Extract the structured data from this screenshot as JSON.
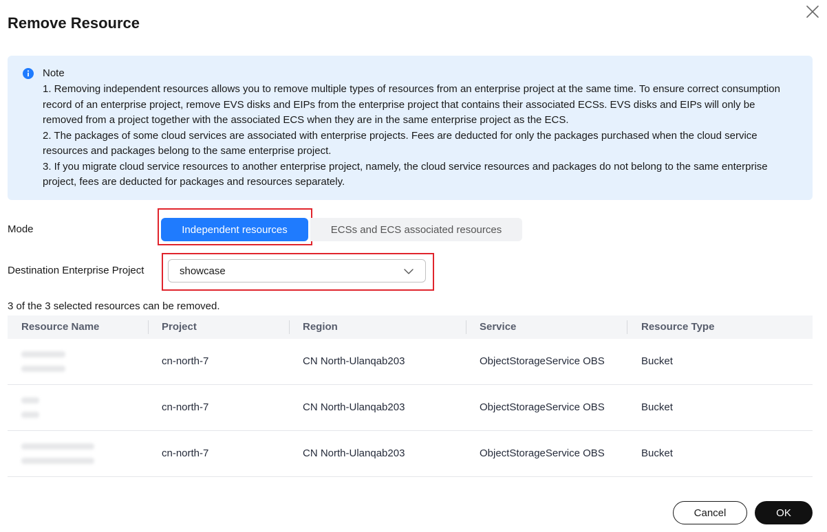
{
  "dialog": {
    "title": "Remove Resource"
  },
  "note": {
    "title": "Note",
    "lines": [
      "1. Removing independent resources allows you to remove multiple types of resources from an enterprise project at the same time. To ensure correct consumption",
      "record of an enterprise project, remove EVS disks and EIPs from the enterprise project that contains their associated ECSs. EVS disks and EIPs will only be",
      "removed from a project together with the associated ECS when they are in the same enterprise project as the ECS.",
      "2. The packages of some cloud services are associated with enterprise projects. Fees are deducted for only the packages purchased when the cloud service",
      "resources and packages belong to the same enterprise project.",
      "3. If you migrate cloud service resources to another enterprise project, namely, the cloud service resources and packages do not belong to the same enterprise",
      "project, fees are deducted for packages and resources separately."
    ]
  },
  "mode": {
    "label": "Mode",
    "options": [
      "Independent resources",
      "ECSs and ECS associated resources"
    ],
    "selected_index": 0
  },
  "destination": {
    "label": "Destination Enterprise Project",
    "value": "showcase"
  },
  "summary": {
    "text": "3 of the 3 selected resources can be removed."
  },
  "table": {
    "columns": [
      "Resource Name",
      "Project",
      "Region",
      "Service",
      "Resource Type"
    ],
    "rows": [
      {
        "project": "cn-north-7",
        "region": "CN North-Ulanqab203",
        "service": "ObjectStorageService OBS",
        "type": "Bucket"
      },
      {
        "project": "cn-north-7",
        "region": "CN North-Ulanqab203",
        "service": "ObjectStorageService OBS",
        "type": "Bucket"
      },
      {
        "project": "cn-north-7",
        "region": "CN North-Ulanqab203",
        "service": "ObjectStorageService OBS",
        "type": "Bucket"
      }
    ]
  },
  "footer": {
    "cancel_label": "Cancel",
    "ok_label": "OK"
  },
  "colors": {
    "primary": "#1f7bfe",
    "highlight": "#e0242c",
    "note_bg": "#e6f1fd",
    "ok_bg": "#111111"
  },
  "icons": {
    "close": "close-icon",
    "info": "info-icon",
    "select_arrow": "chevron-down-icon"
  }
}
